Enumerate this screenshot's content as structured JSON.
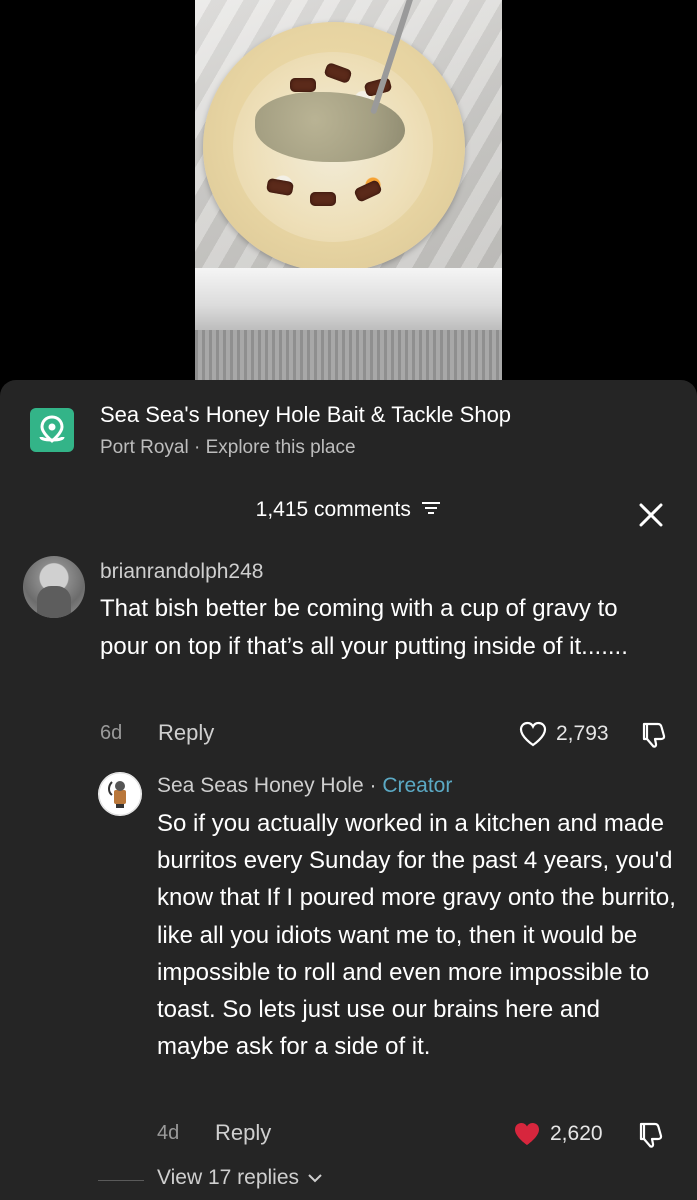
{
  "place": {
    "title": "Sea Sea's Honey Hole Bait & Tackle Shop",
    "subtitle": "Port Royal · Explore this place"
  },
  "comments_header": {
    "count_label": "1,415 comments"
  },
  "comment": {
    "username": "brianrandolph248",
    "text": "That bish better be coming with a cup of gravy to pour on top if that’s all your putting inside of it.......",
    "time": "6d",
    "reply_label": "Reply",
    "likes": "2,793",
    "liked": false
  },
  "reply": {
    "username": "Sea Seas Honey Hole",
    "separator": "·",
    "badge": "Creator",
    "text": "So if you actually worked in a kitchen and made burritos every Sunday for the past 4 years, you'd know that If I poured more gravy onto the burrito, like all you idiots want me to, then it would be impossible to roll and even more impossible to toast. So lets just use our brains here and maybe ask for a side of it.",
    "time": "4d",
    "reply_label": "Reply",
    "likes": "2,620",
    "liked": true
  },
  "view_replies_label": "View 17 replies",
  "colors": {
    "sheet_bg": "#252525",
    "place_icon": "#33b488",
    "creator": "#5ba9c4",
    "liked_heart": "#d7263d"
  }
}
